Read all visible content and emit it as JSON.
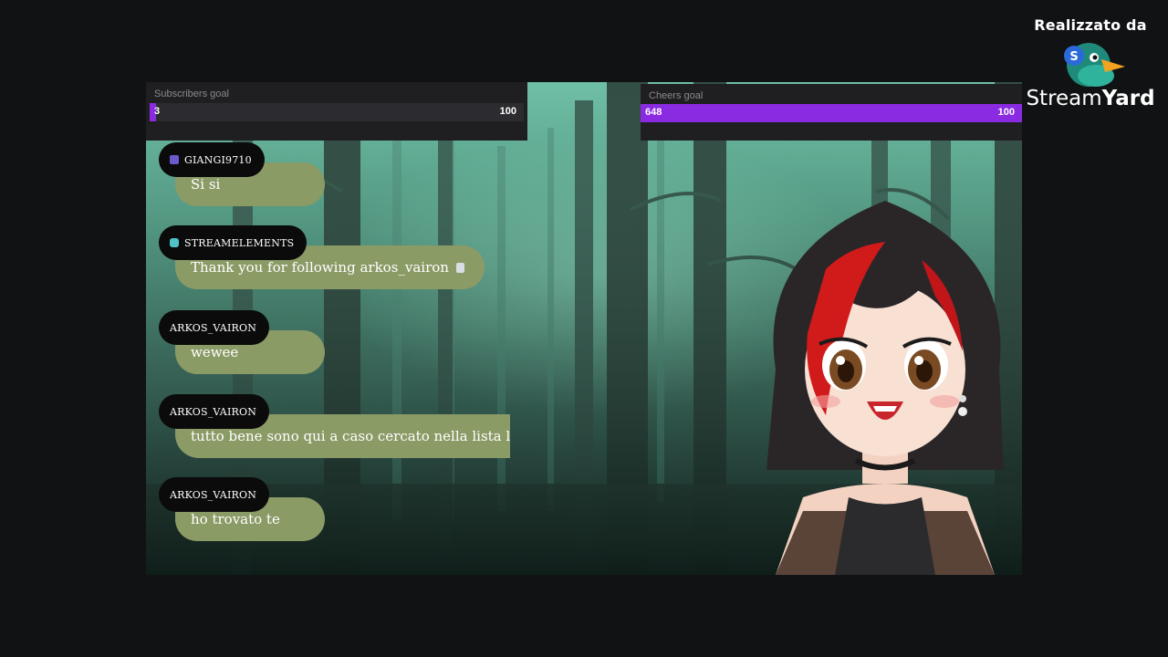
{
  "branding": {
    "caption": "Realizzato da",
    "name_part1": "Stream",
    "name_part2": "Yard",
    "logo_icon": "duck-logo-icon"
  },
  "goals": {
    "subscribers": {
      "title": "Subscribers goal",
      "current": "3",
      "target": "100",
      "progress": 0.0
    },
    "cheers": {
      "title": "Cheers goal",
      "current": "648",
      "target": "100",
      "progress": 1.0
    }
  },
  "chat": [
    {
      "user": "GIANGI9710",
      "badge": "purple",
      "message": "Si si"
    },
    {
      "user": "STREAMELEMENTS",
      "badge": "teal",
      "message": "Thank you for following arkos_vairon",
      "emote": "emote-icon"
    },
    {
      "user": "ARKOS_VAIRON",
      "badge": "",
      "message": "wewee"
    },
    {
      "user": "ARKOS_VAIRON",
      "badge": "",
      "message": "tutto bene sono qui a caso cercato nella lista lung"
    },
    {
      "user": "ARKOS_VAIRON",
      "badge": "",
      "message": "ho trovato te"
    }
  ],
  "colors": {
    "accent_purple": "#8a2be2",
    "chat_bubble": "#8b9b66",
    "name_pill": "#0b0b0b",
    "background": "#111214"
  }
}
